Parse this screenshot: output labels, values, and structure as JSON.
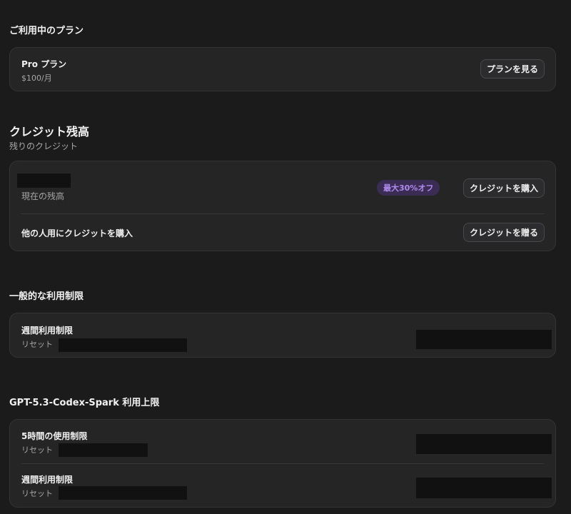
{
  "plan_section": {
    "title": "ご利用中のプラン",
    "plan_name": "Pro プラン",
    "price": "$100/月",
    "view_plans_button": "プランを見る"
  },
  "credits_section": {
    "title": "クレジット残高",
    "subtitle": "残りのクレジット",
    "balance_label": "現在の残高",
    "discount_badge": "最大30%オフ",
    "buy_button": "クレジットを購入",
    "gift_label": "他の人用にクレジットを購入",
    "gift_button": "クレジットを贈る"
  },
  "general_limits": {
    "title": "一般的な利用制限",
    "weekly_label": "週間利用制限",
    "reset_label": "リセット"
  },
  "codex_limits": {
    "title": "GPT-5.3-Codex-Spark 利用上限",
    "five_hour_label": "5時間の使用制限",
    "five_hour_reset": "リセット",
    "weekly_label": "週間利用制限",
    "weekly_reset": "リセット"
  },
  "colors": {
    "background": "#1b1b1c",
    "card": "#252526",
    "badge_bg": "#3a2c52",
    "badge_text": "#b18af0"
  }
}
